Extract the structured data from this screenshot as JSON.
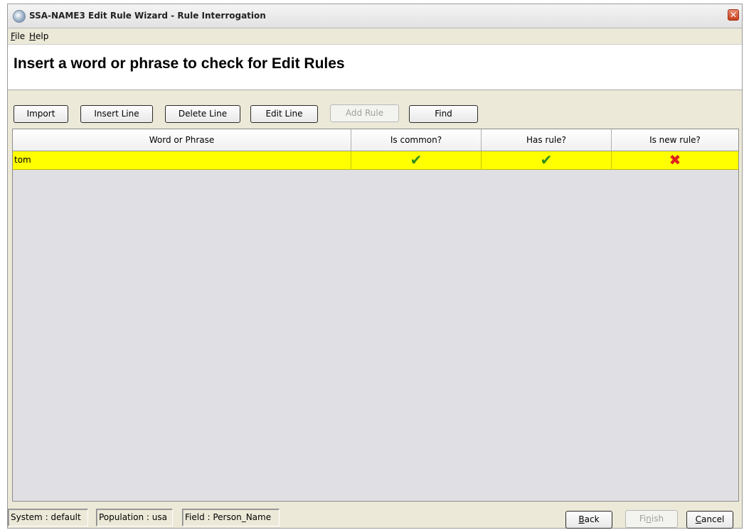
{
  "window": {
    "title": "SSA-NAME3 Edit Rule Wizard - Rule Interrogation",
    "close_symbol": "✕"
  },
  "menu": {
    "file_mnemonic": "F",
    "file_rest": "ile",
    "help_mnemonic": "H",
    "help_rest": "elp"
  },
  "header": {
    "heading": "Insert a word or phrase to check for Edit Rules"
  },
  "toolbar": {
    "import": "Import",
    "insert_line": "Insert Line",
    "delete_line": "Delete Line",
    "edit_line": "Edit Line",
    "add_rule": "Add Rule",
    "find": "Find"
  },
  "table": {
    "columns": [
      "Word or Phrase",
      "Is common?",
      "Has rule?",
      "Is new rule?"
    ],
    "rows": [
      {
        "word": "tom",
        "is_common": "✔",
        "has_rule": "✔",
        "is_new_rule": "✖",
        "is_common_icon": "check-icon",
        "has_rule_icon": "check-icon",
        "is_new_rule_icon": "cross-icon"
      }
    ],
    "selected_row_color": "#ffff00"
  },
  "status": {
    "system": "System : default",
    "population": "Population : usa",
    "field": "Field : Person_Name"
  },
  "nav": {
    "back_mnemonic": "B",
    "back_rest": "ack",
    "finish_pre": "Fi",
    "finish_mnemonic": "n",
    "finish_post": "ish",
    "cancel_mnemonic": "C",
    "cancel_rest": "ancel"
  },
  "colors": {
    "check": "#2e8b1e",
    "cross": "#e02020",
    "close_button": "#c9401d"
  }
}
